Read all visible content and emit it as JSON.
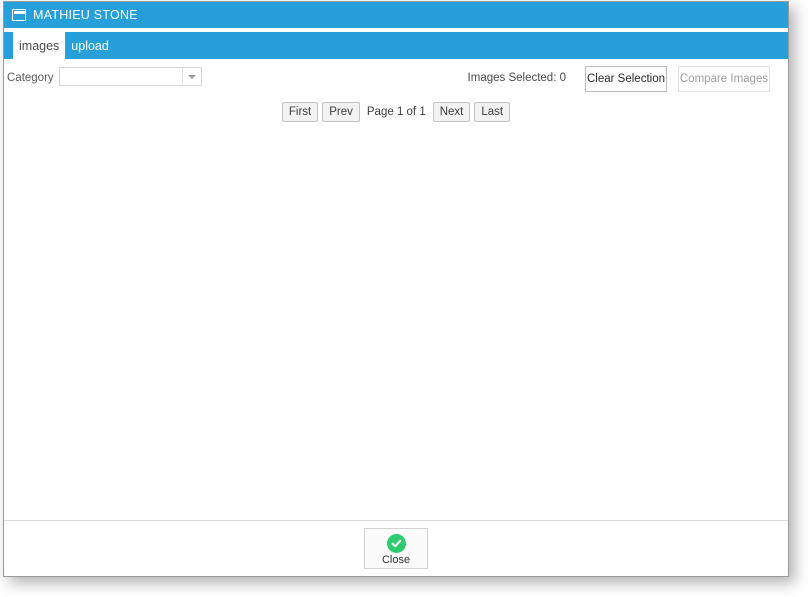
{
  "window": {
    "title": "MATHIEU STONE",
    "icon": "window-icon",
    "accent_color": "#279fd9"
  },
  "tabs": [
    {
      "label": "images",
      "active": true
    },
    {
      "label": "upload",
      "active": false
    }
  ],
  "toolbar": {
    "category_label": "Category",
    "category_value": "",
    "category_placeholder": "",
    "category_arrow_icon": "chevron-down-icon",
    "images_selected_text": "Images Selected: 0",
    "clear_selection_label": "Clear Selection",
    "compare_images_label": "Compare Images",
    "compare_images_disabled": true
  },
  "pagination": {
    "first_label": "First",
    "prev_label": "Prev",
    "page_text": "Page 1 of 1",
    "next_label": "Next",
    "last_label": "Last"
  },
  "footer": {
    "close_label": "Close",
    "close_icon": "check-circle-icon",
    "close_icon_color": "#2ecc71"
  }
}
